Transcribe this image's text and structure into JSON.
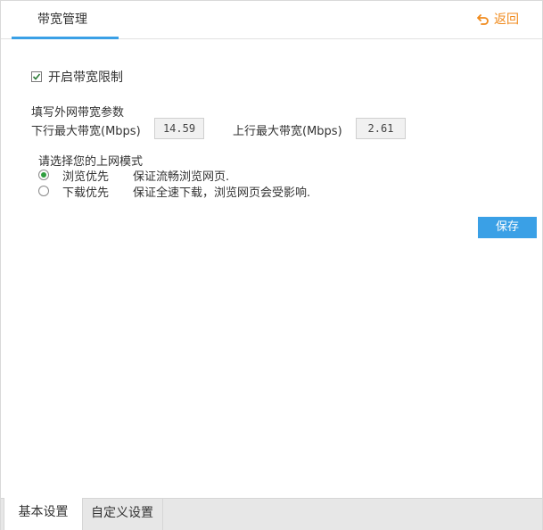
{
  "header": {
    "active_tab": "带宽管理",
    "back_label": "返回"
  },
  "settings": {
    "enable_limit_label": "开启带宽限制",
    "enable_limit_checked": true,
    "params_label": "填写外网带宽参数",
    "download_label": "下行最大带宽(Mbps)",
    "download_value": "14.59",
    "upload_label": "上行最大带宽(Mbps)",
    "upload_value": "2.61",
    "mode_title": "请选择您的上网模式",
    "modes": [
      {
        "name": "浏览优先",
        "desc": "保证流畅浏览网页.",
        "selected": true
      },
      {
        "name": "下载优先",
        "desc": "保证全速下载，浏览网页会受影响.",
        "selected": false
      }
    ],
    "save_label": "保存"
  },
  "bottom_tabs": [
    {
      "label": "基本设置",
      "active": true
    },
    {
      "label": "自定义设置",
      "active": false
    }
  ],
  "colors": {
    "accent": "#3aa0e6",
    "back_link": "#f08a1c",
    "radio_selected": "#2f9e3f"
  }
}
